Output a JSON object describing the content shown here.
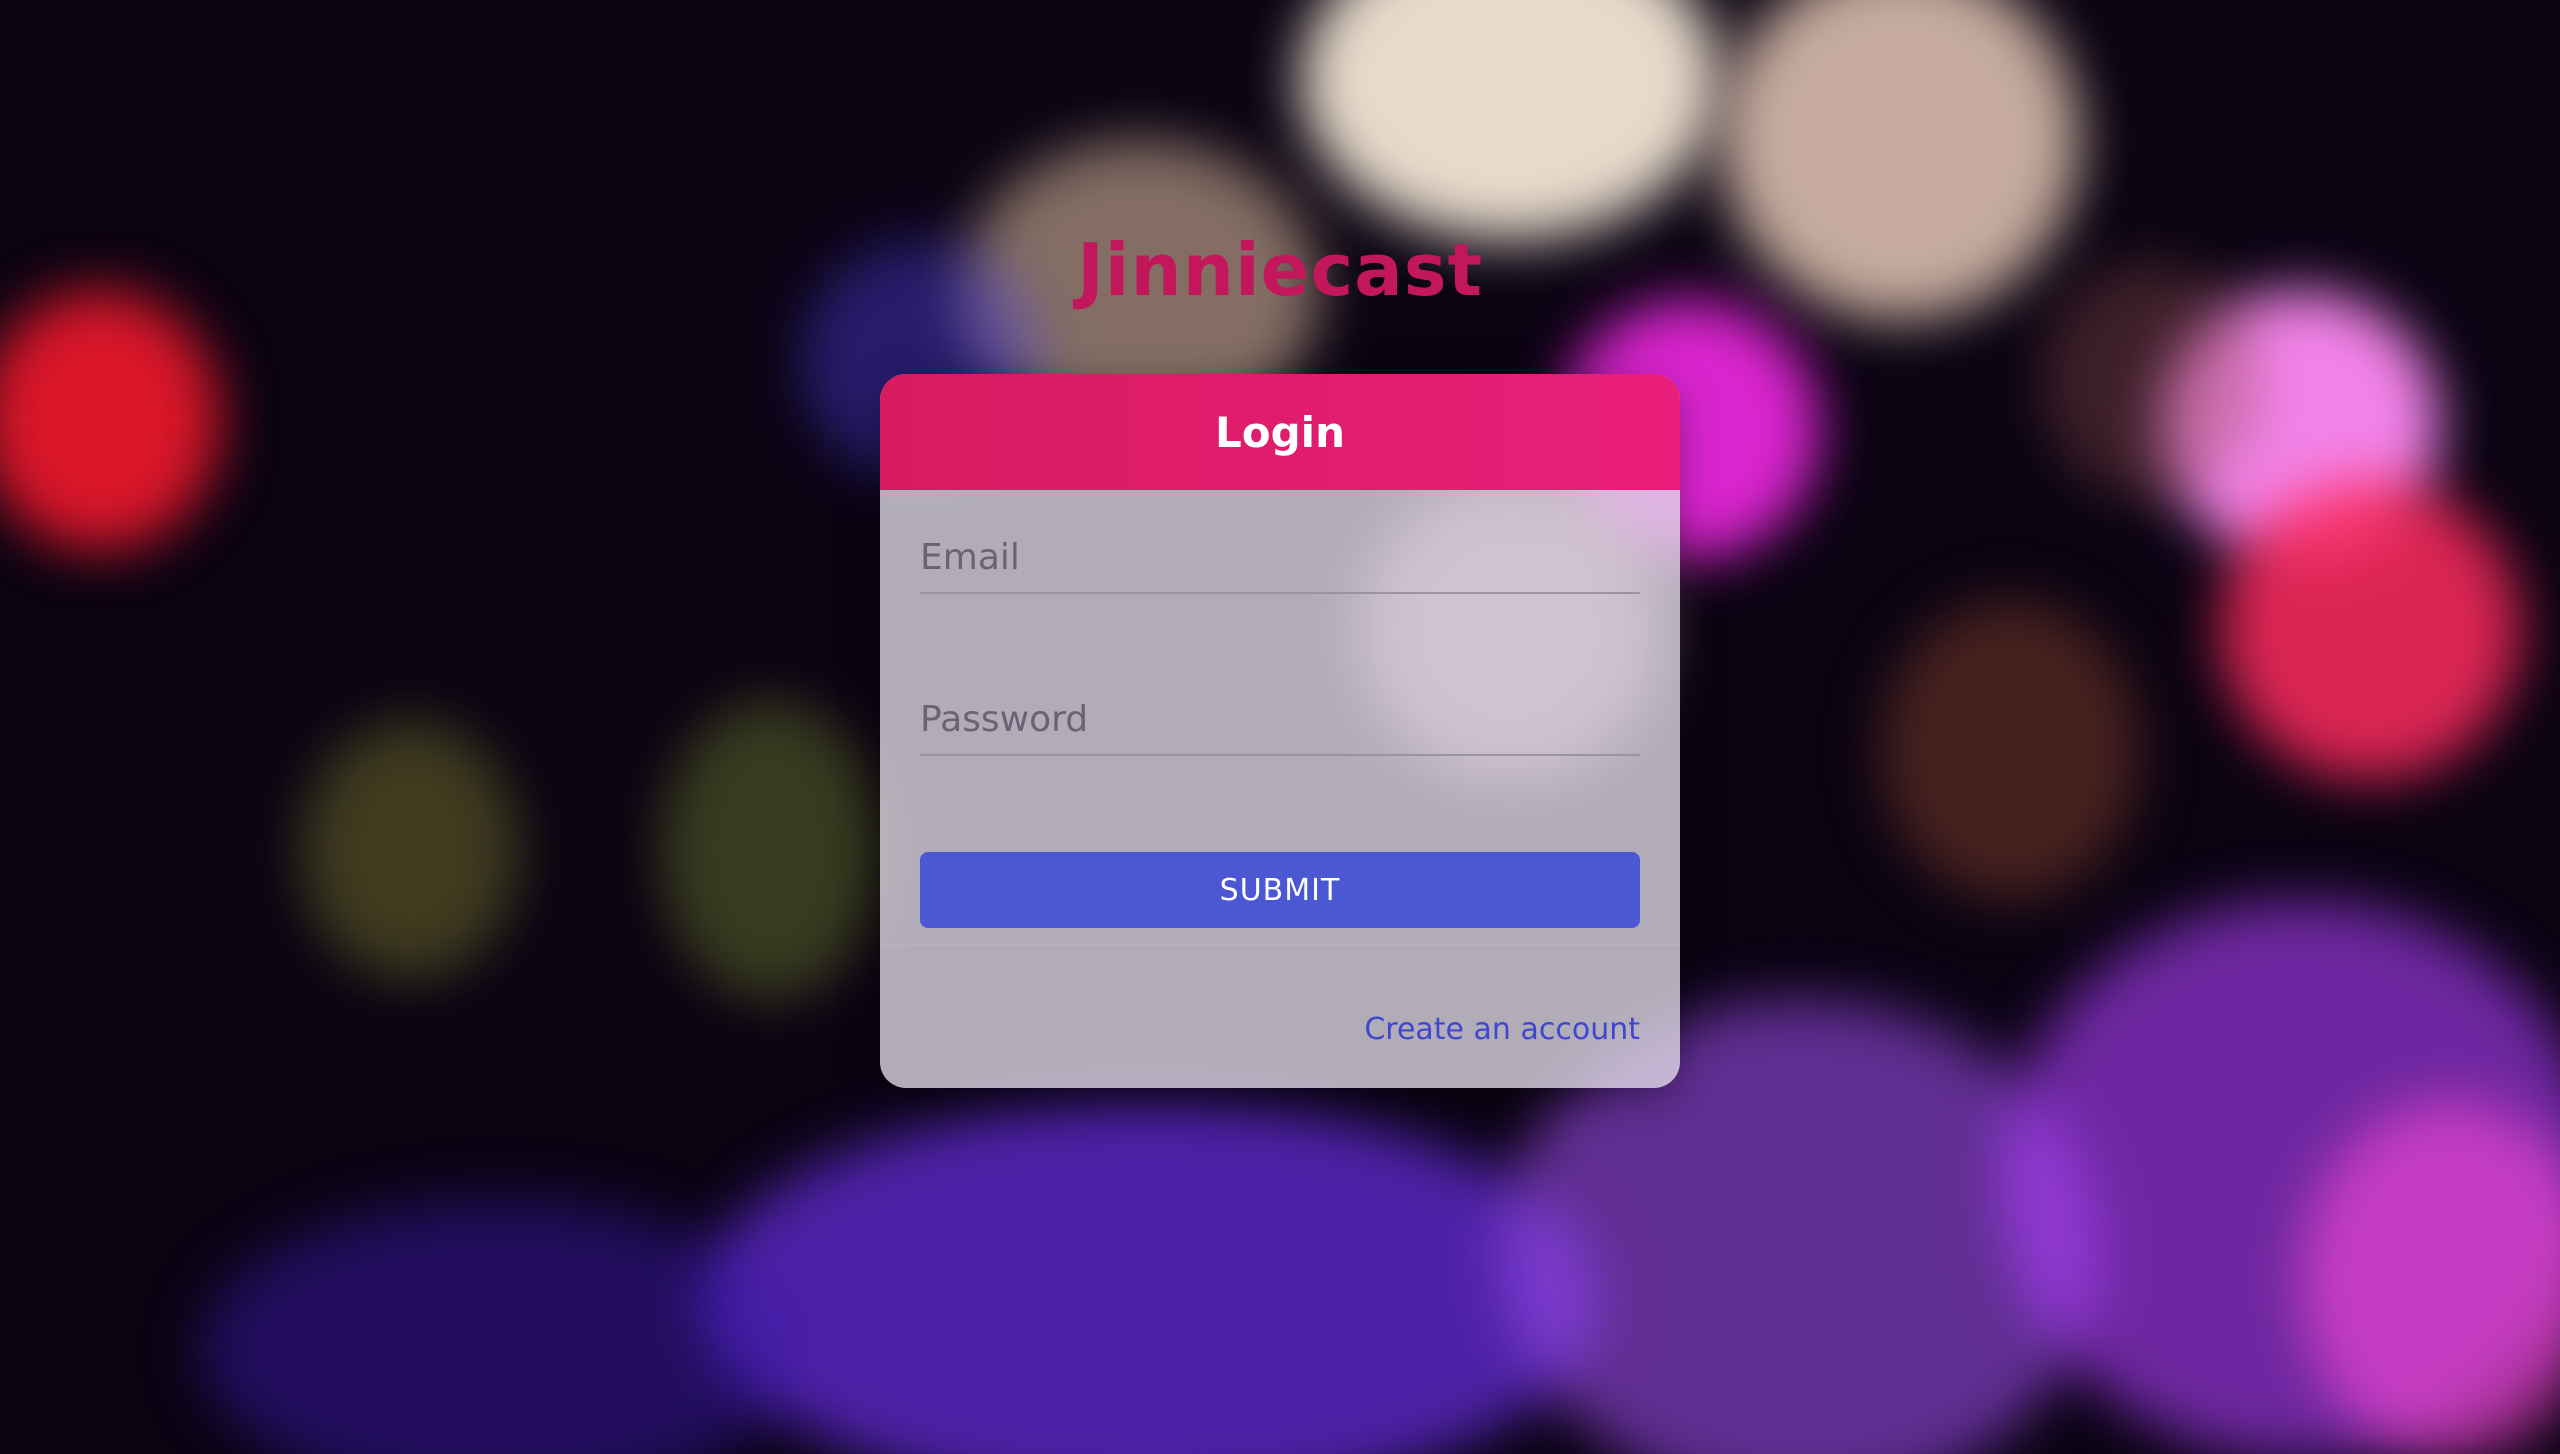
{
  "app": {
    "brand": "Jinniecast"
  },
  "login_card": {
    "title": "Login",
    "email_placeholder": "Email",
    "password_placeholder": "Password",
    "submit_label": "SUBMIT",
    "create_account_label": "Create an account"
  },
  "colors": {
    "brand": "#c2185b",
    "header": "#e91e63",
    "submit": "#4b57d3",
    "link": "#3f48cc"
  }
}
